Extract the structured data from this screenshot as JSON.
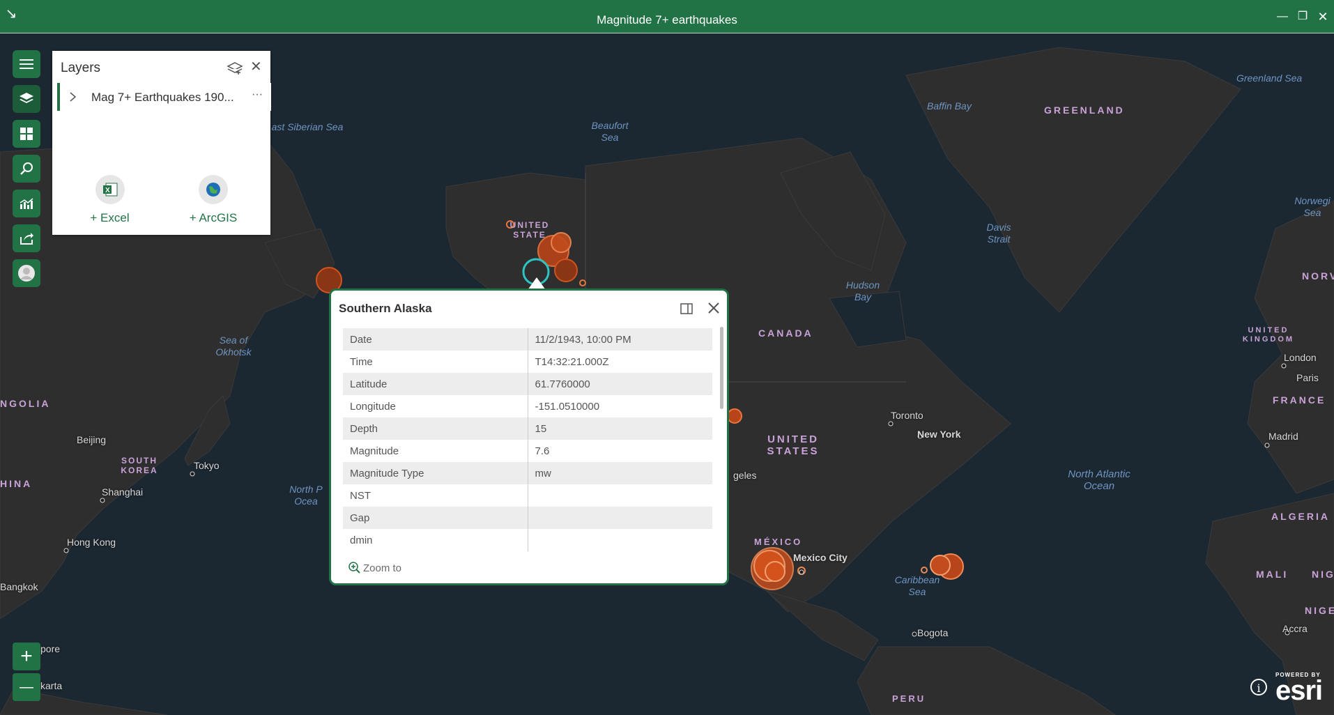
{
  "window": {
    "title": "Magnitude 7+ earthquakes",
    "arrow_icon": "↘",
    "minimize": "—",
    "restore": "❐",
    "close": "✕"
  },
  "layers_panel": {
    "title": "Layers",
    "layer_name": "Mag 7+ Earthquakes 190...",
    "more": "···",
    "add_excel": "+ Excel",
    "add_arcgis": "+ ArcGIS"
  },
  "popup": {
    "title": "Southern Alaska",
    "zoom_to": "Zoom to",
    "rows": [
      {
        "field": "Date",
        "value": "11/2/1943, 10:00 PM"
      },
      {
        "field": "Time",
        "value": "T14:32:21.000Z"
      },
      {
        "field": "Latitude",
        "value": "61.7760000"
      },
      {
        "field": "Longitude",
        "value": "-151.0510000"
      },
      {
        "field": "Depth",
        "value": "15"
      },
      {
        "field": "Magnitude",
        "value": "7.6"
      },
      {
        "field": "Magnitude Type",
        "value": "mw"
      },
      {
        "field": "NST",
        "value": ""
      },
      {
        "field": "Gap",
        "value": ""
      },
      {
        "field": "dmin",
        "value": ""
      }
    ]
  },
  "zoom": {
    "in": "+",
    "out": "—"
  },
  "attribution": {
    "powered_by": "POWERED BY",
    "brand": "esri",
    "info": "i"
  },
  "map_labels": {
    "greenland_sea": "Greenland Sea",
    "baffin_bay": "Baffin Bay",
    "greenland": "GREENLAND",
    "east_siberian_sea": "ast Siberian Sea",
    "beaufort_sea": "Beaufort Sea",
    "davis_strait": "Davis Strait",
    "norwegian_sea": "Norwegi Sea",
    "norway": "NORV",
    "hudson_bay": "Hudson Bay",
    "united_kingdom": "UNITED KINGDOM",
    "london": "London",
    "paris": "Paris",
    "france": "FRANCE",
    "canada": "CANADA",
    "sea_of_okhotsk": "Sea of Okhotsk",
    "mongolia": "NGOLIA",
    "beijing": "Beijing",
    "south_korea": "SOUTH KOREA",
    "tokyo": "Tokyo",
    "china": "HINA",
    "shanghai": "Shanghai",
    "hong_kong": "Hong Kong",
    "bangkok": "Bangkok",
    "singapore": "pore",
    "jakarta": "karta",
    "north_pacific": "North P Ocea",
    "united_states_alaska": "UNITED STATE",
    "toronto": "Toronto",
    "new_york": "New York",
    "madrid": "Madrid",
    "united_states": "UNITED STATES",
    "los_angeles": "geles",
    "north_atlantic": "North Atlantic Ocean",
    "algeria": "ALGERIA",
    "mexico": "MÉXICO",
    "mexico_city": "Mexico City",
    "caribbean_sea": "Caribbean Sea",
    "mali": "MALI",
    "niger_short": "NIG",
    "nigeria": "NIGE",
    "accra": "Accra",
    "bogota": "Bogota",
    "peru": "PERU"
  },
  "colors": {
    "accent": "#217346",
    "map_bg": "#1b2731",
    "land": "#2e2e2e",
    "quake": "#d4531c",
    "selected": "#2ec4c4"
  }
}
